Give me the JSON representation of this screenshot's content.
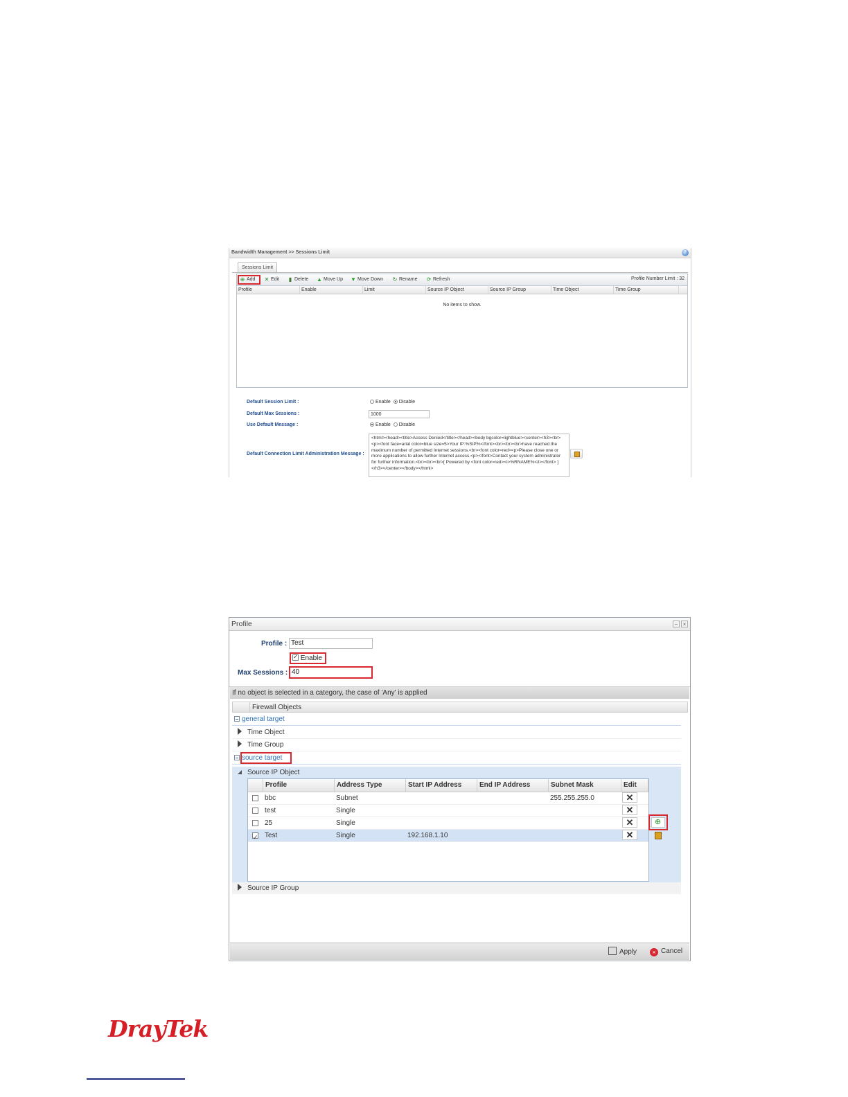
{
  "shot1": {
    "title": "Bandwidth Management >> Sessions Limit",
    "tab": "Sessions Limit",
    "toolbar": {
      "add": "Add",
      "edit": "Edit",
      "delete": "Delete",
      "move_up": "Move Up",
      "move_down": "Move Down",
      "rename": "Rename",
      "refresh": "Refresh",
      "profile_limit": "Profile Number Limit : 32"
    },
    "columns": [
      "Profile",
      "Enable",
      "Limit",
      "Source IP Object",
      "Source IP Group",
      "Time Object",
      "Time Group"
    ],
    "empty_text": "No items to show.",
    "form": {
      "default_session_limit_label": "Default Session Limit :",
      "default_session_limit_options": [
        "Enable",
        "Disable"
      ],
      "default_session_limit_selected": "Disable",
      "default_max_sessions_label": "Default Max Sessions :",
      "default_max_sessions_value": "1000",
      "use_default_message_label": "Use Default Message :",
      "use_default_message_options": [
        "Enable",
        "Disable"
      ],
      "use_default_message_selected": "Enable",
      "admin_message_label": "Default Connection Limit Administration Message :",
      "admin_message_value": "<html><head><title>Access Denied</title></head><body bgcolor=lightblue><center><h3><br><p><font face=arial color=blue size=5>Your IP:%SIP%</font><br><br><br>have reached the maximum number of permitted Internet sessions.<br><font color=red><p>Please close one or more applications to allow further Internet access.<p></font>Contact your system administrator for further information.<br><br><br>[ Powered by <font color=red><i>%RNAME%</i></font> ]</h3></center></body></html>"
    }
  },
  "shot2": {
    "title": "Profile",
    "profile_label": "Profile :",
    "profile_value": "Test",
    "enable_label": "Enable",
    "enable_checked": true,
    "max_sessions_label": "Max Sessions :",
    "max_sessions_value": "40",
    "note": "If no object is selected in a category, the case of 'Any' is applied",
    "objects_header": "Firewall Objects",
    "general_target": "general target",
    "time_object": "Time Object",
    "time_group": "Time Group",
    "source_target": "source target",
    "source_ip_object": "Source IP Object",
    "source_ip_group": "Source IP Group",
    "grid_columns": [
      "Profile",
      "Address Type",
      "Start IP Address",
      "End IP Address",
      "Subnet Mask",
      "Edit"
    ],
    "grid_rows": [
      {
        "checked": false,
        "profile": "bbc",
        "type": "Subnet",
        "start": "",
        "end": "",
        "mask": "255.255.255.0"
      },
      {
        "checked": false,
        "profile": "test",
        "type": "Single",
        "start": "",
        "end": "",
        "mask": ""
      },
      {
        "checked": false,
        "profile": "25",
        "type": "Single",
        "start": "",
        "end": "",
        "mask": ""
      },
      {
        "checked": true,
        "profile": "Test",
        "type": "Single",
        "start": "192.168.1.10",
        "end": "",
        "mask": ""
      }
    ],
    "apply": "Apply",
    "cancel": "Cancel"
  },
  "logo": "DrayTek",
  "colors": {
    "highlight": "#d7282f",
    "logo": "#d51e25",
    "label_blue": "#1f4e8f",
    "selected_row": "#d3e2f5"
  }
}
